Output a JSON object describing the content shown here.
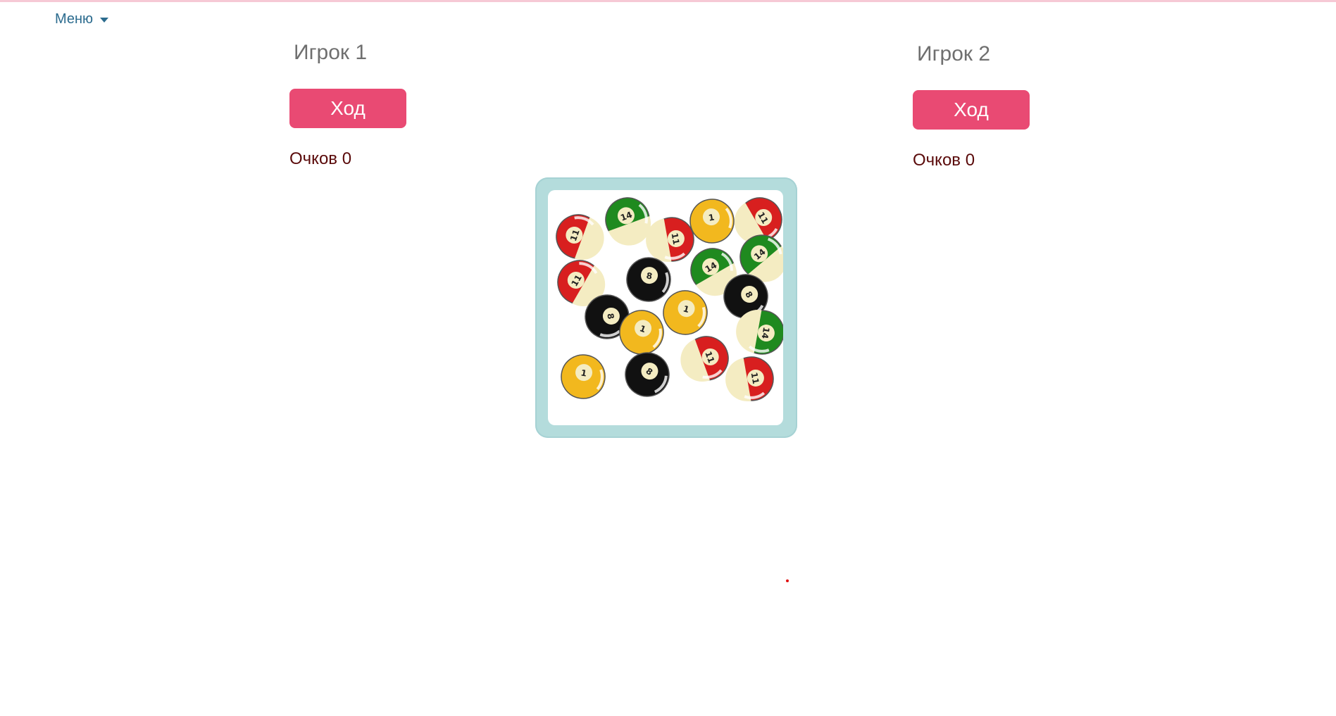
{
  "header": {
    "menu_label": "Меню"
  },
  "players": [
    {
      "name": "Игрок 1",
      "move_label": "Ход",
      "score_text": "Очков 0"
    },
    {
      "name": "Игрок 2",
      "move_label": "Ход",
      "score_text": "Очков 0"
    }
  ],
  "colors": {
    "accent": "#e94a73",
    "menu": "#2b6b8e",
    "card_border": "#b4dcdc",
    "score_text": "#5a0a0a"
  },
  "card": {
    "balls": [
      {
        "number": "11",
        "color": "red"
      },
      {
        "number": "14",
        "color": "green"
      },
      {
        "number": "11",
        "color": "red"
      },
      {
        "number": "1",
        "color": "yellow"
      },
      {
        "number": "11",
        "color": "red"
      },
      {
        "number": "11",
        "color": "red"
      },
      {
        "number": "8",
        "color": "black"
      },
      {
        "number": "14",
        "color": "green"
      },
      {
        "number": "14",
        "color": "green"
      },
      {
        "number": "8",
        "color": "black"
      },
      {
        "number": "1",
        "color": "yellow"
      },
      {
        "number": "8",
        "color": "black"
      },
      {
        "number": "1",
        "color": "yellow"
      },
      {
        "number": "14",
        "color": "green"
      },
      {
        "number": "11",
        "color": "red"
      },
      {
        "number": "1",
        "color": "yellow"
      },
      {
        "number": "8",
        "color": "black"
      },
      {
        "number": "11",
        "color": "red"
      }
    ]
  }
}
